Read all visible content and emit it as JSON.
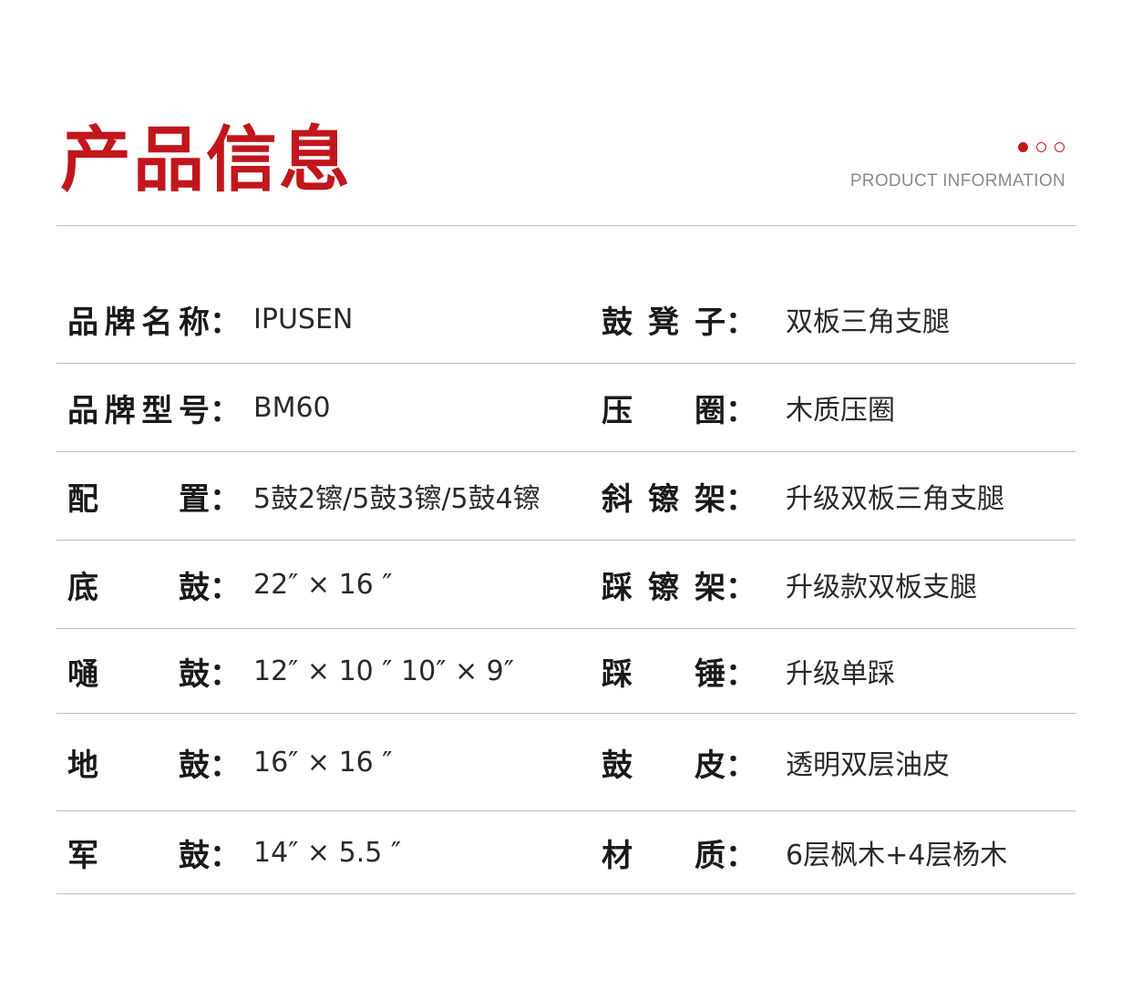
{
  "header": {
    "title": "产品信息",
    "subtitle": "PRODUCT INFORMATION",
    "accent_color": "#c0161c"
  },
  "colon": "：",
  "rows": [
    {
      "left_label": [
        "品",
        "牌",
        "名",
        "称"
      ],
      "left_value": "IPUSEN",
      "right_label": [
        "鼓",
        "凳",
        "子"
      ],
      "right_value": "双板三角支腿"
    },
    {
      "left_label": [
        "品",
        "牌",
        "型",
        "号"
      ],
      "left_value": "BM60",
      "right_label": [
        "压",
        "圈"
      ],
      "right_value": "木质压圈"
    },
    {
      "left_label": [
        "配",
        "置"
      ],
      "left_value": "5鼓2镲/5鼓3镲/5鼓4镲",
      "right_label": [
        "斜",
        "镲",
        "架"
      ],
      "right_value": "升级双板三角支腿"
    },
    {
      "left_label": [
        "底",
        "鼓"
      ],
      "left_value": "22″ × 16 ″",
      "right_label": [
        "踩",
        "镲",
        "架"
      ],
      "right_value": "升级款双板支腿"
    },
    {
      "left_label": [
        "嗵",
        "鼓"
      ],
      "left_value": "12″ × 10 ″  10″ × 9″",
      "right_label": [
        "踩",
        "锤"
      ],
      "right_value": "升级单踩"
    },
    {
      "left_label": [
        "地",
        "鼓"
      ],
      "left_value": "16″ × 16 ″",
      "right_label": [
        "鼓",
        "皮"
      ],
      "right_value": "透明双层油皮"
    },
    {
      "left_label": [
        "军",
        "鼓"
      ],
      "left_value": "14″ × 5.5 ″",
      "right_label": [
        "材",
        "质"
      ],
      "right_value": "6层枫木+4层杨木"
    }
  ]
}
